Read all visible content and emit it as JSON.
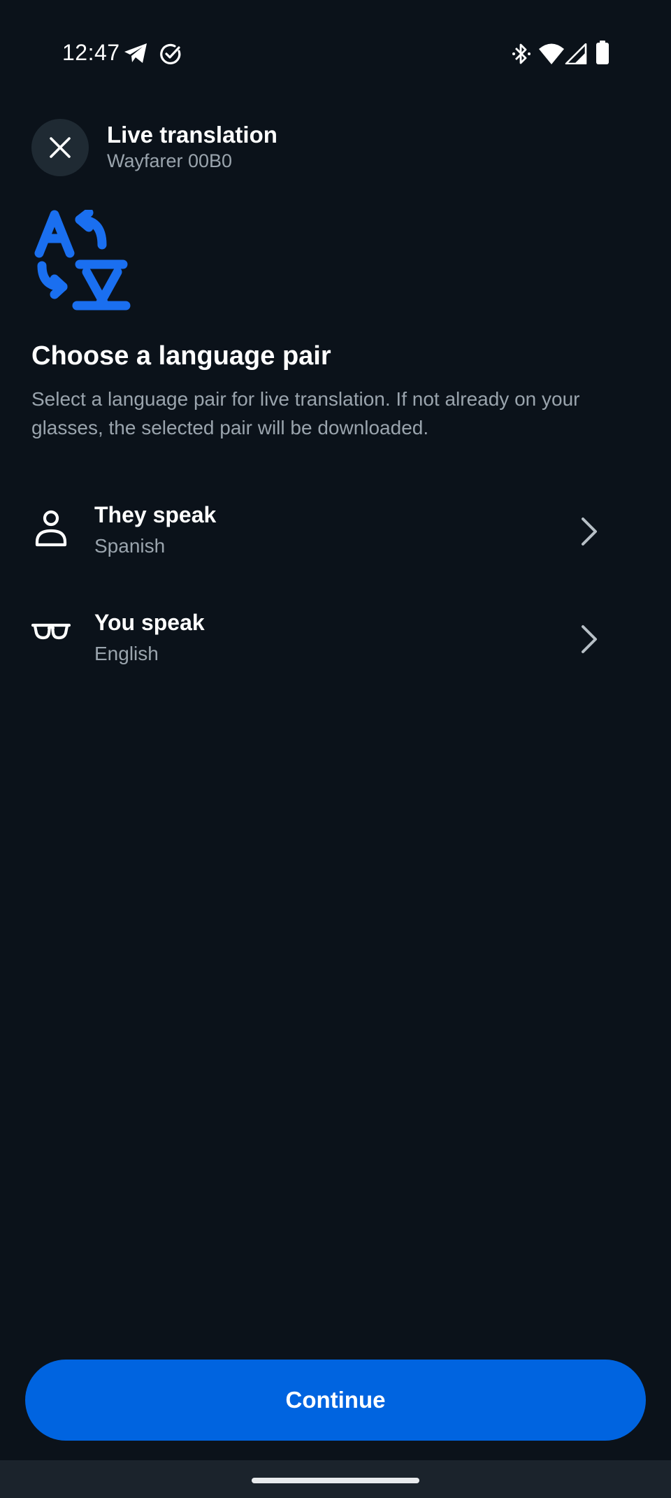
{
  "status_bar": {
    "time": "12:47",
    "left_icons": [
      "telegram-icon",
      "check-circle-icon"
    ],
    "right_icons": [
      "bluetooth-icon",
      "wifi-icon",
      "signal-icon",
      "battery-icon"
    ]
  },
  "header": {
    "title": "Live translation",
    "subtitle": "Wayfarer 00B0",
    "close_icon": "close-icon"
  },
  "hero_icon": "translate-icon",
  "section": {
    "title": "Choose a language pair",
    "description": "Select a language pair for live translation. If not already on your glasses, the selected pair will be downloaded."
  },
  "languages": [
    {
      "icon": "person-icon",
      "label": "They speak",
      "value": "Spanish"
    },
    {
      "icon": "glasses-icon",
      "label": "You speak",
      "value": "English"
    }
  ],
  "continue_label": "Continue",
  "colors": {
    "background": "#0b121a",
    "accent": "#0064e0",
    "icon_blue": "#1a6ff0",
    "secondary_text": "#9aa4ad"
  }
}
